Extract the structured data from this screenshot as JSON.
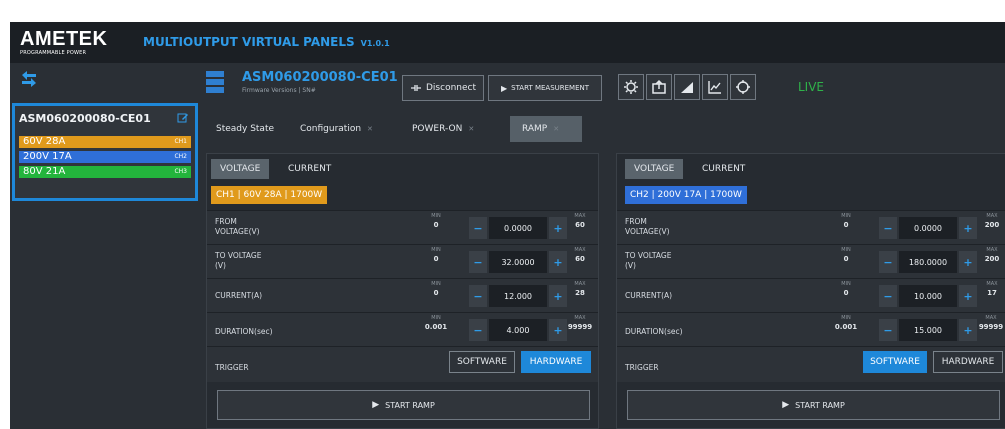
{
  "header": {
    "brand": "AMETEK",
    "brand_sub": "PROGRAMMABLE POWER",
    "app_title": "MULTIOUTPUT VIRTUAL PANELS",
    "app_version": "V1.0.1"
  },
  "sidebar": {
    "device_name": "ASM060200080-CE01",
    "channels": [
      {
        "label": "60V 28A",
        "tag": "CH1",
        "color": "#e09a1c"
      },
      {
        "label": "200V 17A",
        "tag": "CH2",
        "color": "#2f6fd8"
      },
      {
        "label": "80V 21A",
        "tag": "CH3",
        "color": "#23b43c"
      }
    ]
  },
  "device": {
    "title": "ASM060200080-CE01",
    "firmware": "Firmware Versions  |  SN#",
    "disconnect_label": "Disconnect",
    "start_measurement_label": "START MEASUREMENT",
    "live_label": "LIVE"
  },
  "tabs": [
    {
      "label": "Steady State",
      "closable": false
    },
    {
      "label": "Configuration",
      "closable": true
    },
    {
      "label": "POWER-ON",
      "closable": true
    },
    {
      "label": "RAMP",
      "closable": true,
      "active": true
    }
  ],
  "panels": [
    {
      "subtabs": [
        "VOLTAGE",
        "CURRENT"
      ],
      "chip": "CH1 | 60V 28A | 1700W",
      "chip_color": "#e09a1c",
      "rows": [
        {
          "label": "FROM\nVOLTAGE(V)",
          "min": "0",
          "value": "0.0000",
          "max": "60"
        },
        {
          "label": "TO VOLTAGE\n(V)",
          "min": "0",
          "value": "32.0000",
          "max": "60"
        },
        {
          "label": "CURRENT(A)",
          "min": "0",
          "value": "12.000",
          "max": "28"
        },
        {
          "label": "DURATION(sec)",
          "min": "0.001",
          "value": "4.000",
          "max": "99999"
        }
      ],
      "trigger_label": "TRIGGER",
      "trigger_software": "SOFTWARE",
      "trigger_hardware": "HARDWARE",
      "trigger_selected": "HARDWARE",
      "start_ramp": "START RAMP"
    },
    {
      "subtabs": [
        "VOLTAGE",
        "CURRENT"
      ],
      "chip": "CH2 | 200V 17A | 1700W",
      "chip_color": "#2f6fd8",
      "rows": [
        {
          "label": "FROM\nVOLTAGE(V)",
          "min": "0",
          "value": "0.0000",
          "max": "200"
        },
        {
          "label": "TO VOLTAGE\n(V)",
          "min": "0",
          "value": "180.0000",
          "max": "200"
        },
        {
          "label": "CURRENT(A)",
          "min": "0",
          "value": "10.000",
          "max": "17"
        },
        {
          "label": "DURATION(sec)",
          "min": "0.001",
          "value": "15.000",
          "max": "99999"
        }
      ],
      "trigger_label": "TRIGGER",
      "trigger_software": "SOFTWARE",
      "trigger_hardware": "HARDWARE",
      "trigger_selected": "SOFTWARE",
      "start_ramp": "START RAMP"
    }
  ],
  "labels": {
    "min": "MIN",
    "max": "MAX",
    "minus": "−",
    "plus": "+"
  }
}
